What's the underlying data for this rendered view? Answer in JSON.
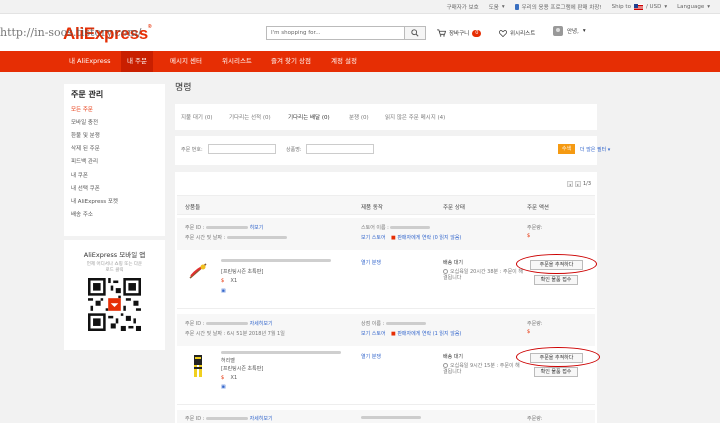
{
  "topbar": {
    "links": [
      "구매자가 보호",
      "도움",
      "우리의 응용 프로그램에 판매 차장!",
      "Ship to",
      "/ USD",
      "Language"
    ]
  },
  "header": {
    "logo": "AliExpress",
    "watermark": "http://in-soos.tistory.com/",
    "search_placeholder": "I'm shopping for...",
    "cart_label": "장바구니",
    "cart_count": "0",
    "wishlist_label": "위시리스트",
    "user_label": "안녕,"
  },
  "nav": {
    "items": [
      "내 AliExpress",
      "내 주문",
      "메시지 센터",
      "위시리스트",
      "즐겨 찾기 상점",
      "계정 설정"
    ]
  },
  "sidebar": {
    "title": "주문 관리",
    "items": [
      "모든 주문",
      "모바일 충전",
      "환불 및 분쟁",
      "삭제 된 주문",
      "피드백 관리",
      "내 쿠폰",
      "내 선택 쿠폰",
      "내 AliExpress 포켓",
      "배송 주소"
    ]
  },
  "app": {
    "title": "AliExpress 모바일 앱",
    "subtitle": "언제 어디서나 쇼핑 또는 다운로드 클릭"
  },
  "main": {
    "title": "명령",
    "tabs": [
      "지불 대기 (0)",
      "기다리는 선적 (0)",
      "기다리는 배달 (0)",
      "분쟁 (0)",
      "읽지 않은 주문 메시지 (4)"
    ],
    "filters": {
      "order_no_label": "주문 번호:",
      "product_label": "상품명:",
      "search_btn": "수색",
      "more_link": "더 많은 필터"
    },
    "pager": "1/3",
    "columns": [
      "상품들",
      "제품 동작",
      "주문 상태",
      "주문 액션"
    ]
  },
  "orders": [
    {
      "id_label": "주문 ID :",
      "id_link": "히보기",
      "time_label": "주문 시간 및 날짜 :",
      "store_label": "스토어 이름 :",
      "store_link": "보기 스토어",
      "contact": "판매자에게 연락 (0 읽지 않음)",
      "amount_label": "주문량:",
      "amount": "$",
      "item_note": "[프린팅시즌 초특판]",
      "qty": "X1",
      "action": "열기 분쟁",
      "status": "배송 대기",
      "countdown": "오십육일 20시간 38분 : 주문이 해결됩니다",
      "track_btn": "주문을 추적하다",
      "confirm_btn": "확인 물품 접수"
    },
    {
      "id_label": "주문 ID :",
      "id_link": "자세히보기",
      "time_label": "주문 시간 및 날짜 : 6시 51분 2018년 7월 1일",
      "store_label": "상점 이름 :",
      "store_link": "보기 스토어",
      "contact": "판매자에게 연락 (1 읽지 않음)",
      "amount_label": "주문량:",
      "amount": "$",
      "item_name": "허리벨",
      "item_note": "[프린팅시즌 초특판]",
      "qty": "X1",
      "action": "열기 분쟁",
      "status": "배송 대기",
      "countdown": "오십육일 9시간 15분 : 주문이 해결됩니다",
      "track_btn": "주문을 추적하다",
      "confirm_btn": "확인 물품 접수"
    },
    {
      "id_label": "주문 ID :",
      "id_link": "자세히보기",
      "amount_label": "주문량:"
    }
  ]
}
